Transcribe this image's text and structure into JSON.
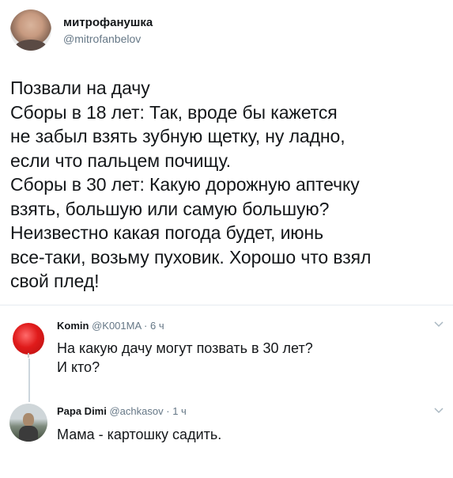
{
  "tweet": {
    "author_name": "митрофанушка",
    "author_handle": "@mitrofanbelov",
    "text": "Позвали на дачу\nСборы в 18 лет: Так, вроде бы кажется\nне забыл взять зубную щетку, ну ладно,\nесли что пальцем почищу.\nСборы в 30 лет: Какую дорожную аптечку\nвзять, большую или самую большую?\nНеизвестно какая погода будет, июнь\nвсе-таки, возьму пуховик. Хорошо что взял\nсвой плед!"
  },
  "replies": [
    {
      "name": "Komin",
      "handle": "@K001MA",
      "sep": "·",
      "time": "6 ч",
      "text": "На какую дачу могут позвать в 30 лет?\nИ кто?",
      "avatar_color": "#e01b1b"
    },
    {
      "name": "Papa Dimi",
      "handle": "@achkasov",
      "sep": "·",
      "time": "1 ч",
      "text": "Мама - картошку садить."
    }
  ],
  "icons": {
    "menu": "chevron-down-icon"
  },
  "colors": {
    "muted": "#657786",
    "text": "#14171a",
    "divider": "#e6ecf0",
    "thread": "#ccd6dd"
  }
}
